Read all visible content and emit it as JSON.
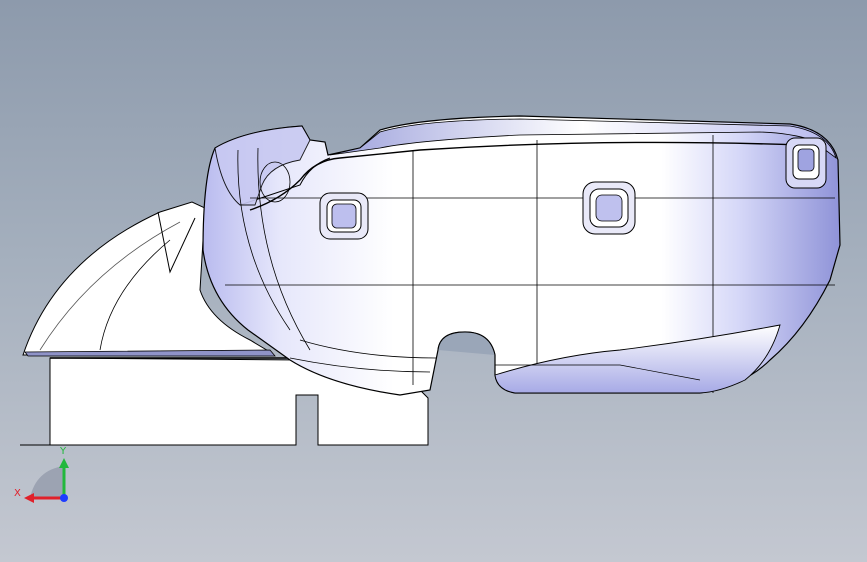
{
  "viewport": {
    "background_top": "#8d9aac",
    "background_bottom": "#c4c8d1"
  },
  "model": {
    "shell_color": "#ffffff",
    "shade_color": "#b4b6ec",
    "edge_color": "#000000"
  },
  "triad": {
    "x_label": "X",
    "y_label": "Y",
    "x_color": "#e0202a",
    "y_color": "#22b83c",
    "z_color": "#1e3cff"
  }
}
